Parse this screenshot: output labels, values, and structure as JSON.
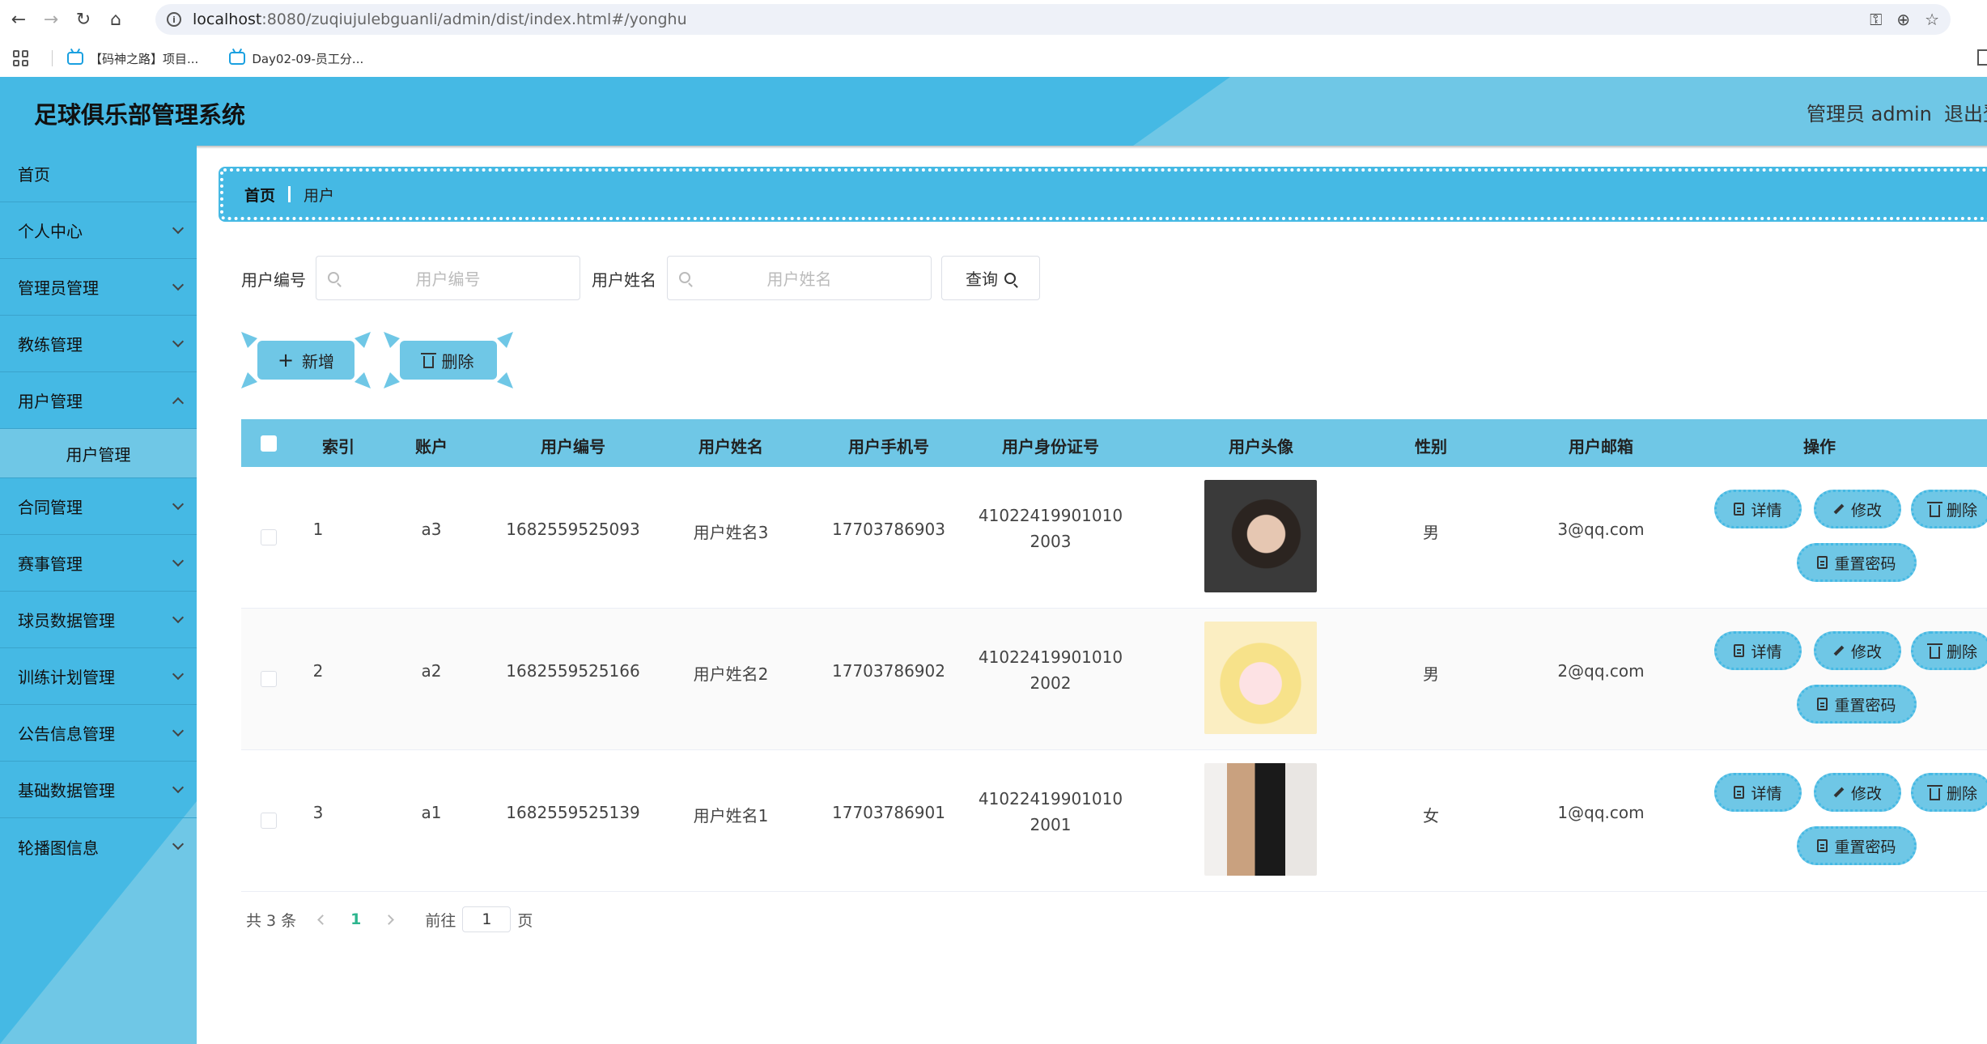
{
  "browser": {
    "url_host": "localhost",
    "url_rest": ":8080/zuqiujulebguanli/admin/dist/index.html#/yonghu",
    "bookmarks": [
      "【码神之路】项目...",
      "Day02-09-员工分..."
    ]
  },
  "header": {
    "title": "足球俱乐部管理系统",
    "admin": "管理员 admin",
    "logout": "退出登录"
  },
  "sidebar": {
    "items": [
      {
        "label": "首页"
      },
      {
        "label": "个人中心"
      },
      {
        "label": "管理员管理"
      },
      {
        "label": "教练管理"
      },
      {
        "label": "用户管理"
      },
      {
        "label": "合同管理"
      },
      {
        "label": "赛事管理"
      },
      {
        "label": "球员数据管理"
      },
      {
        "label": "训练计划管理"
      },
      {
        "label": "公告信息管理"
      },
      {
        "label": "基础数据管理"
      },
      {
        "label": "轮播图信息"
      }
    ],
    "submenu": {
      "label": "用户管理"
    }
  },
  "breadcrumb": {
    "home": "首页",
    "current": "用户"
  },
  "search": {
    "user_no_label": "用户编号",
    "user_no_placeholder": "用户编号",
    "user_name_label": "用户姓名",
    "user_name_placeholder": "用户姓名",
    "query": "查询"
  },
  "actions": {
    "add": "新增",
    "delete": "删除"
  },
  "table": {
    "headers": {
      "index": "索引",
      "account": "账户",
      "user_no": "用户编号",
      "user_name": "用户姓名",
      "phone": "用户手机号",
      "id_card": "用户身份证号",
      "avatar": "用户头像",
      "gender": "性别",
      "email": "用户邮箱",
      "ops": "操作"
    },
    "rows": [
      {
        "index": "1",
        "account": "a3",
        "user_no": "1682559525093",
        "user_name": "用户姓名3",
        "phone": "17703786903",
        "id1": "41022419901010",
        "id2": "2003",
        "gender": "男",
        "email": "3@qq.com"
      },
      {
        "index": "2",
        "account": "a2",
        "user_no": "1682559525166",
        "user_name": "用户姓名2",
        "phone": "17703786902",
        "id1": "41022419901010",
        "id2": "2002",
        "gender": "男",
        "email": "2@qq.com"
      },
      {
        "index": "3",
        "account": "a1",
        "user_no": "1682559525139",
        "user_name": "用户姓名1",
        "phone": "17703786901",
        "id1": "41022419901010",
        "id2": "2001",
        "gender": "女",
        "email": "1@qq.com"
      }
    ],
    "ops": {
      "detail": "详情",
      "edit": "修改",
      "delete": "删除",
      "reset": "重置密码"
    }
  },
  "pager": {
    "total": "共 3 条",
    "current": "1",
    "goto": "前往",
    "goto_value": "1",
    "page": "页"
  }
}
